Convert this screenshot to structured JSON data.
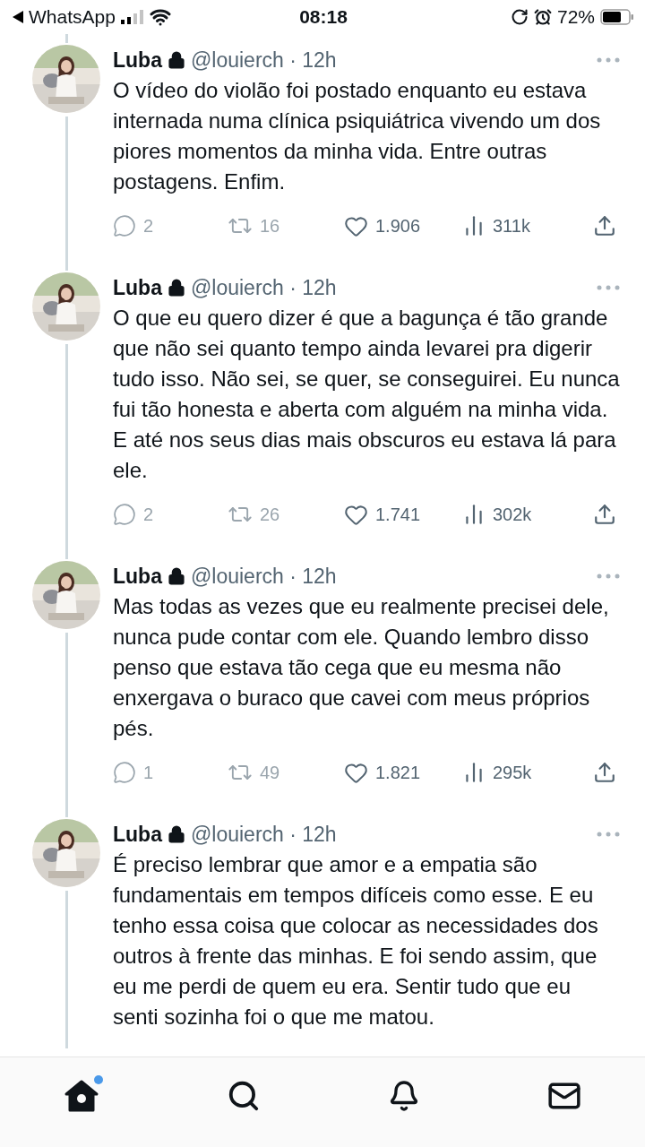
{
  "status_bar": {
    "back_app": "WhatsApp",
    "time": "08:18",
    "battery_text": "72%"
  },
  "tweets": [
    {
      "author": "Luba",
      "handle_time": "@louierch · 12h",
      "text": "O vídeo do violão foi postado enquanto eu estava internada numa clínica psiquiátrica vivendo um dos piores momentos da minha vida. Entre outras postagens. Enfim.",
      "actions": [
        {
          "kind": "reply",
          "count": "2",
          "dimmed": true
        },
        {
          "kind": "retweet",
          "count": "16",
          "dimmed": true
        },
        {
          "kind": "like",
          "count": "1.906",
          "dimmed": false
        },
        {
          "kind": "views",
          "count": "311k",
          "dimmed": false
        },
        {
          "kind": "share",
          "dimmed": false
        }
      ]
    },
    {
      "author": "Luba",
      "handle_time": "@louierch · 12h",
      "text": "O que eu quero dizer é que a bagunça é tão grande que não sei quanto tempo ainda levarei pra digerir tudo isso. Não sei, se quer, se conseguirei. Eu nunca fui tão honesta e aberta com alguém na minha vida. E até nos seus dias mais obscuros eu estava lá para ele.",
      "actions": [
        {
          "kind": "reply",
          "count": "2",
          "dimmed": true
        },
        {
          "kind": "retweet",
          "count": "26",
          "dimmed": true
        },
        {
          "kind": "like",
          "count": "1.741",
          "dimmed": false
        },
        {
          "kind": "views",
          "count": "302k",
          "dimmed": false
        },
        {
          "kind": "share",
          "dimmed": false
        }
      ]
    },
    {
      "author": "Luba",
      "handle_time": "@louierch · 12h",
      "text": "Mas todas as vezes que eu realmente precisei dele, nunca pude contar com ele. Quando lembro disso penso que estava tão cega que eu mesma não enxergava o buraco que cavei com meus próprios pés.",
      "actions": [
        {
          "kind": "reply",
          "count": "1",
          "dimmed": true
        },
        {
          "kind": "retweet",
          "count": "49",
          "dimmed": true
        },
        {
          "kind": "like",
          "count": "1.821",
          "dimmed": false
        },
        {
          "kind": "views",
          "count": "295k",
          "dimmed": false
        },
        {
          "kind": "share",
          "dimmed": false
        }
      ]
    },
    {
      "author": "Luba",
      "handle_time": "@louierch · 12h",
      "text": "É preciso lembrar que amor e a empatia são fundamentais em tempos difíceis como esse. E eu tenho essa coisa que colocar as necessidades dos outros à frente das minhas. E foi sendo assim, que eu me perdi de quem eu era. Sentir tudo que eu senti sozinha foi o que me matou."
    }
  ],
  "bottom_nav": [
    {
      "kind": "home",
      "selected": true,
      "badge": true
    },
    {
      "kind": "search",
      "selected": false,
      "badge": false
    },
    {
      "kind": "notifications",
      "selected": false,
      "badge": false
    },
    {
      "kind": "messages",
      "selected": false,
      "badge": false
    }
  ]
}
